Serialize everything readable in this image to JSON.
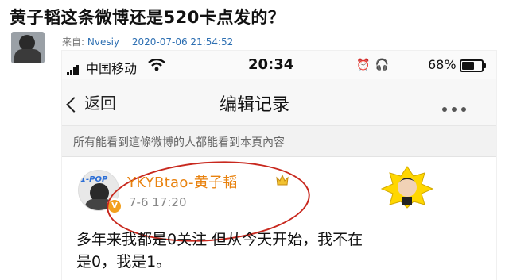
{
  "post": {
    "title": "黄子韬这条微博还是520卡点发的？",
    "source_label": "来自: ",
    "source_user": "Nvesiy",
    "datetime": "2020-07-06 21:54:52"
  },
  "status_bar": {
    "carrier": "中国移动",
    "time": "20:34",
    "battery": "68%",
    "battery_level": 0.68
  },
  "nav": {
    "back_label": "返回",
    "title": "编辑记录"
  },
  "notice": "所有能看到這條微博的人都能看到本頁內容",
  "weibo": {
    "username": "YKYBtao-黄子韬",
    "time": "7-6 17:20",
    "avatar_logo": "1-POP",
    "verified_badge": "V",
    "text_line1": "多年来我都是0关注 但从今天开始，我不在",
    "text_line2": "是0，我是1。"
  },
  "colors": {
    "username": "#e8820f",
    "annotation_circle": "#c8281e",
    "link": "#2d6fb2"
  }
}
